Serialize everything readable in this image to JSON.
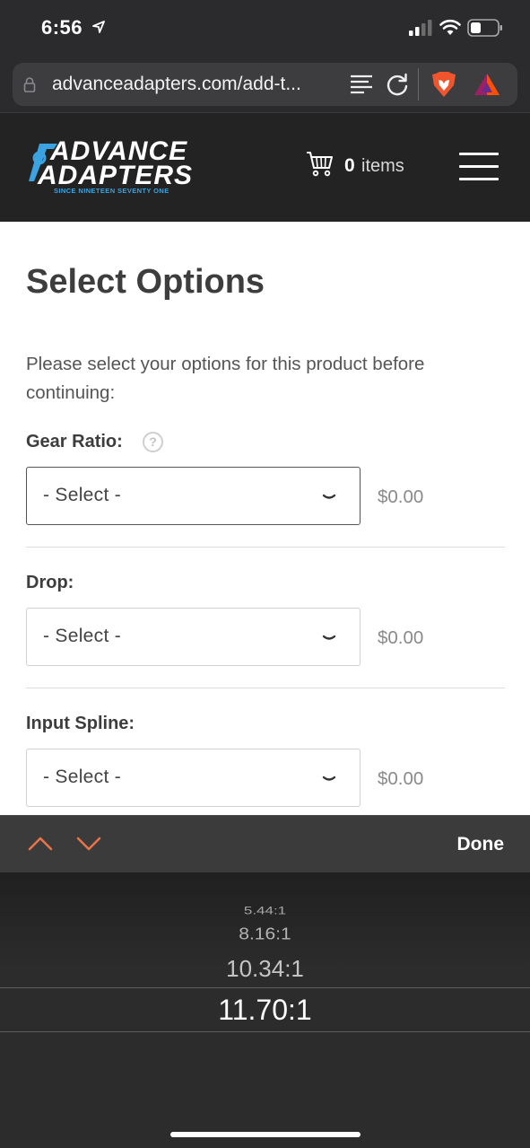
{
  "status_bar": {
    "time": "6:56"
  },
  "browser": {
    "url": "advanceadapters.com/add-t..."
  },
  "header": {
    "logo_line1": "ADVANCE",
    "logo_line2": "ADAPTERS",
    "logo_tagline": "SINCE NINETEEN SEVENTY ONE",
    "cart_count": "0",
    "cart_label": "items",
    "logo_colors": {
      "text": "#ffffff",
      "accent": "#3aa3e0"
    }
  },
  "main": {
    "title": "Select Options",
    "intro": "Please select your options for this product before continuing:",
    "options": [
      {
        "label": "Gear Ratio:",
        "value": "- Select -",
        "price": "$0.00",
        "help": "?"
      },
      {
        "label": "Drop:",
        "value": "- Select -",
        "price": "$0.00"
      },
      {
        "label": "Input Spline:",
        "value": "- Select -",
        "price": "$0.00"
      }
    ]
  },
  "keyboard_toolbar": {
    "done_label": "Done",
    "accent_color": "#e8734a"
  },
  "picker": {
    "items": [
      "5.44:1",
      "8.16:1",
      "10.34:1"
    ],
    "selected": "11.70:1"
  },
  "icons": [
    "location-arrow-icon",
    "signal-icon",
    "wifi-icon",
    "battery-icon",
    "lock-icon",
    "reader-mode-icon",
    "reload-icon",
    "brave-shield-icon",
    "bat-rewards-icon",
    "cart-icon",
    "menu-icon",
    "help-icon",
    "chevron-down-icon",
    "chevron-up-icon"
  ]
}
